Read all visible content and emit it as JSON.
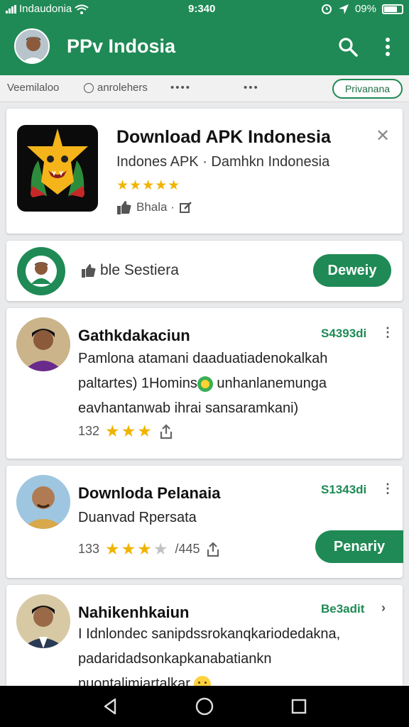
{
  "status_bar": {
    "carrier": "Indaudonia",
    "time": "9:340",
    "battery": "09%"
  },
  "app_bar": {
    "title": "PPv Indosia"
  },
  "filters": {
    "chip_1": "Veemilaloo",
    "chip_2": "anrolehers",
    "chip_3": "••••",
    "chip_4": "•••",
    "pill": "Privanana"
  },
  "featured": {
    "title": "Download APK Indonesia",
    "subtitle": "Indones APK · Damhkn Indonesia",
    "stars": "★★★★★",
    "meta": "Bhala ·"
  },
  "promo": {
    "text": "ble Sestiera",
    "button": "Deweiy"
  },
  "posts": [
    {
      "title": "Gathkdakaciun",
      "price": "S4393di",
      "line_1": "Pamlona atamani daaduatiadenokalkah",
      "line_2a": "paltartes) 1Homins",
      "line_2b": "unhanlanemunga",
      "line_3": "eavhantanwab ihrai sansaramkani)",
      "count": "132",
      "stars": "★★★"
    },
    {
      "title": "Downloda Pelanaia",
      "price": "S1343di",
      "line_1": "Duanvad Rpersata",
      "count": "133",
      "stars_on": "★★★",
      "stars_off": "★",
      "extra": "/445",
      "button": "Penariy"
    },
    {
      "title": "Nahikenhkaiun",
      "price": "Be3adit",
      "line_1": "I Idnlondec sanipdssrokanqkariodedakna,",
      "line_2": "padaridadsonkapkanabatiankn",
      "line_3": "nuontalimiartalkar"
    }
  ],
  "colors": {
    "primary": "#1f8a55",
    "star": "#f0b400",
    "background": "#e9eaec"
  }
}
